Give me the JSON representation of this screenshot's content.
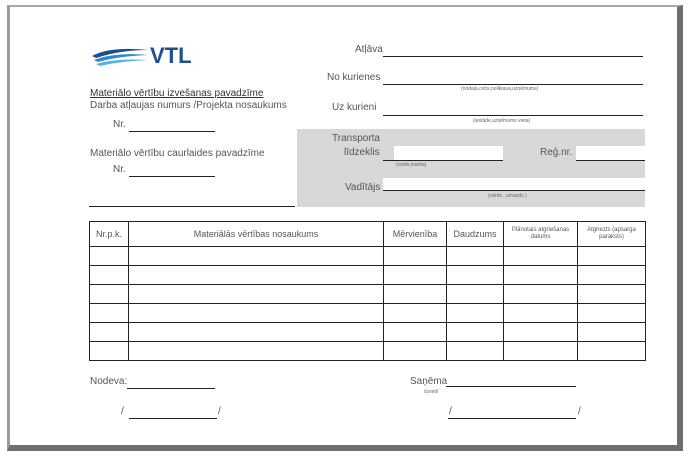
{
  "logo": {
    "text": "VTL"
  },
  "form": {
    "title": "Materiālo vērtību izvešanas pavadzīme",
    "permit_label": "Darba atļaujas numurs /Projekta nosaukums",
    "nr_label_1": "Nr.",
    "pass_label": "Materiālo vērtību caurlaides pavadzīme",
    "nr_label_2": "Nr."
  },
  "right": {
    "atlava": "Atļāva",
    "no_kurienes": "No kurienes",
    "no_kurienes_hint": "(nodaļa,cehs,noliktava,uzņēmums)",
    "uz_kurieni": "Uz kurieni",
    "uz_kurieni_hint": "(iestāde,uzņēmums vieta)",
    "transporta": "Transporta",
    "lidzeklis": "līdzeklis",
    "lidzeklis_hint": "(veids,marka)",
    "reg_nr": "Reģ.nr.",
    "vaditajs": "Vadītājs",
    "vaditajs_hint": "(vārds , uzvards )"
  },
  "table": {
    "headers": [
      "Nr.p.k.",
      "Materiālās vērtības nosaukums",
      "Mērvienība",
      "Daudzums",
      "Plānotais atgriešanas datums",
      "Atgriezts (apsarga paraksts)"
    ],
    "row_count": 6
  },
  "footer": {
    "nodeva": "Nodeva:",
    "sanema": "Saņēma",
    "sanema_hint": "/izved/",
    "slash": "/"
  },
  "colors": {
    "logo_blue": "#1d4f8f",
    "wave_light": "#4fb3e8",
    "shade": "#d8d8d8"
  }
}
